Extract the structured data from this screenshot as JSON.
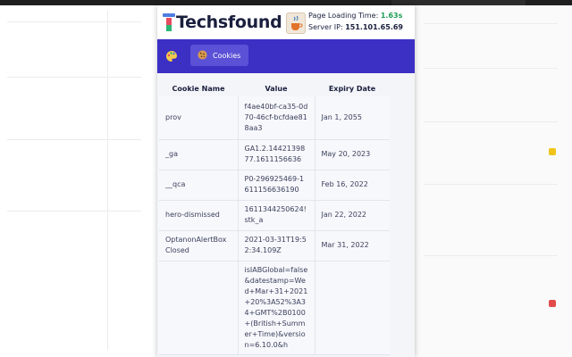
{
  "header": {
    "logo_text": "Techsfound",
    "load_label": "Page Loading Time: ",
    "load_value": "1.63s",
    "ip_label": "Server IP: ",
    "ip_value": "151.101.65.69"
  },
  "nav": {
    "tab_cookies": "Cookies"
  },
  "table": {
    "headers": [
      "Cookie Name",
      "Value",
      "Expiry Date"
    ],
    "rows": [
      {
        "name": "prov",
        "value": "f4ae40bf-ca35-0d70-46cf-bcfdae818aa3",
        "expiry": "Jan 1, 2055"
      },
      {
        "name": "_ga",
        "value": "GA1.2.1442139877.1611156636",
        "expiry": "May 20, 2023"
      },
      {
        "name": "__qca",
        "value": "P0-296925469-1611156636190",
        "expiry": "Feb 16, 2022"
      },
      {
        "name": "hero-dismissed",
        "value": "1611344250624!stk_a",
        "expiry": "Jan 22, 2022"
      },
      {
        "name": "OptanonAlertBoxClosed",
        "value": "2021-03-31T19:52:34.109Z",
        "expiry": "Mar 31, 2022"
      },
      {
        "name": "",
        "value": "isIABGlobal=false&datestamp=Wed+Mar+31+2021+20%3A52%3A34+GMT%2B0100+(British+Summer+Time)&version=6.10.0&h",
        "expiry": ""
      }
    ]
  },
  "colors": {
    "nav_bg": "#3c2fc4",
    "tab_bg": "#5b51d6",
    "accent_green": "#1f9d55",
    "text_dark": "#1a1f3d"
  },
  "icons": {
    "nav_icon": "palette-icon",
    "tab_icon": "cookie-icon",
    "header_icon": "java-cup-icon"
  }
}
